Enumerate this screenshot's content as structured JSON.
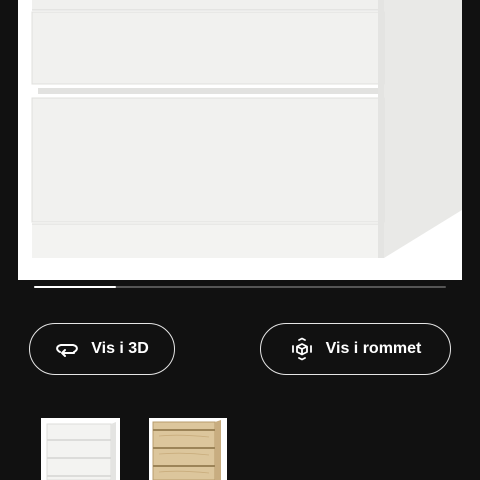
{
  "product": {
    "image": "white-chest-of-drawers",
    "gallery_progress": 0.2
  },
  "actions": {
    "view_3d": {
      "label": "Vis i 3D",
      "icon": "rotate-3d-icon"
    },
    "view_room": {
      "label": "Vis i rommet",
      "icon": "ar-cube-icon"
    }
  },
  "thumbnails": [
    {
      "name": "white-variant",
      "color": "#f4f4f4"
    },
    {
      "name": "oak-variant",
      "color": "#d9c39a"
    }
  ],
  "colors": {
    "background": "#111111",
    "pill_border": "#e6e6e6",
    "text": "#ffffff"
  }
}
